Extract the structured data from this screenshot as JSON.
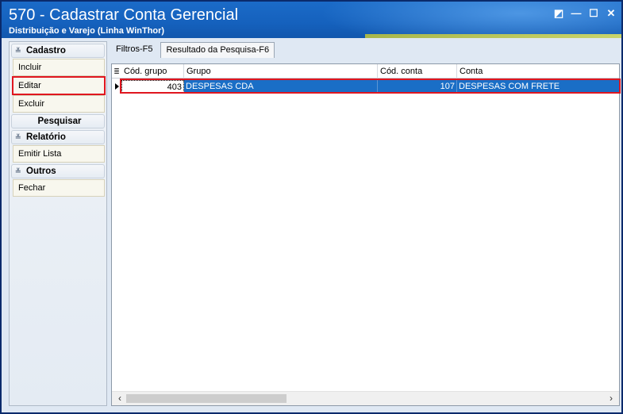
{
  "window": {
    "title": "570 - Cadastrar Conta Gerencial",
    "subtitle": "Distribuição e Varejo (Linha WinThor)",
    "controls": {
      "restore": "◩",
      "minimize": "—",
      "maximize": "☐",
      "close": "✕"
    }
  },
  "sidebar": {
    "cadastro": {
      "label": "Cadastro",
      "items": [
        "Incluir",
        "Editar",
        "Excluir"
      ]
    },
    "pesquisar": {
      "label": "Pesquisar"
    },
    "relatorio": {
      "label": "Relatório",
      "items": [
        "Emitir Lista"
      ]
    },
    "outros": {
      "label": "Outros",
      "items": [
        "Fechar"
      ]
    }
  },
  "tabs": [
    {
      "label": "Filtros-F5",
      "active": false
    },
    {
      "label": "Resultado da Pesquisa-F6",
      "active": true
    }
  ],
  "grid": {
    "columns": [
      "Cód. grupo",
      "Grupo",
      "Cód. conta",
      "Conta"
    ],
    "rows": [
      {
        "cod_grupo": "403",
        "grupo": "DESPESAS CDA",
        "cod_conta": "107",
        "conta": "DESPESAS COM FRETE"
      }
    ]
  },
  "colors": {
    "title_bar": "#1561bd",
    "selection": "#1a6ec6",
    "highlight": "#e0161f"
  },
  "icons": {
    "column-chooser": "≣",
    "scroll-left": "‹",
    "scroll-right": "›",
    "collapse": "≚"
  }
}
